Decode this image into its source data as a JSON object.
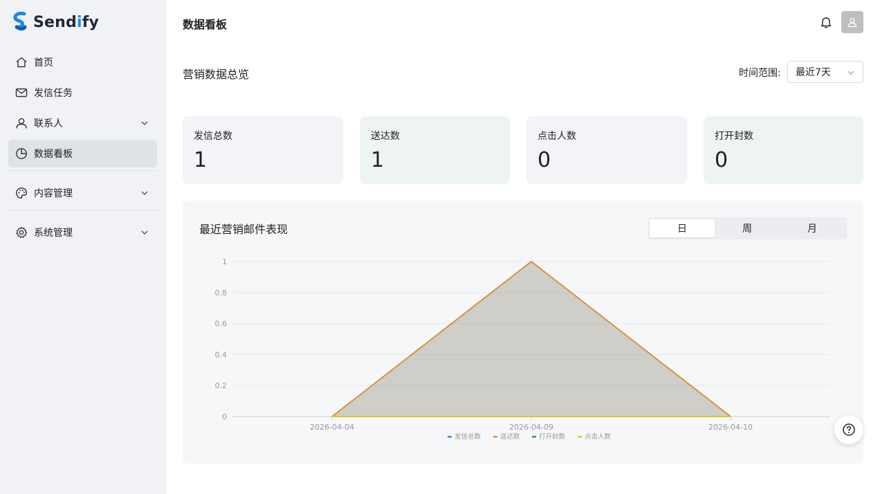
{
  "app": {
    "name_prefix": "Send",
    "name_accent": "i",
    "name_suffix": "fy"
  },
  "sidebar": {
    "items": [
      {
        "label": "首页",
        "icon": "home-icon"
      },
      {
        "label": "发信任务",
        "icon": "mail-icon"
      },
      {
        "label": "联系人",
        "icon": "user-icon",
        "expandable": true
      },
      {
        "label": "数据看板",
        "icon": "pie-chart-icon",
        "active": true
      },
      {
        "label": "内容管理",
        "icon": "palette-icon",
        "expandable": true
      },
      {
        "label": "系统管理",
        "icon": "gear-icon",
        "expandable": true
      }
    ]
  },
  "header": {
    "title": "数据看板"
  },
  "overview": {
    "title": "营销数据总览",
    "range_label": "时间范围:",
    "range_value": "最近7天"
  },
  "stats": [
    {
      "label": "发信总数",
      "value": "1"
    },
    {
      "label": "送达数",
      "value": "1"
    },
    {
      "label": "点击人数",
      "value": "0"
    },
    {
      "label": "打开封数",
      "value": "0"
    }
  ],
  "performance": {
    "title": "最近营销邮件表现",
    "periods": [
      {
        "label": "日",
        "active": true
      },
      {
        "label": "周",
        "active": false
      },
      {
        "label": "月",
        "active": false
      }
    ]
  },
  "colors": {
    "accent": "#1e88e5",
    "series_sent": "#3b82f6",
    "series_delivered": "#e8912a",
    "series_opened": "#22a06b",
    "series_clicked": "#f5c518"
  },
  "chart_data": {
    "type": "area",
    "x": [
      "2026-04-04",
      "2026-04-09",
      "2026-04-10"
    ],
    "ylim": [
      0,
      1
    ],
    "yticks": [
      "0",
      "0.2",
      "0.4",
      "0.6",
      "0.8",
      "1"
    ],
    "grid": true,
    "legend_position": "bottom",
    "series": [
      {
        "name": "发信总数",
        "values": [
          0,
          1,
          0
        ],
        "color": "#3b82f6"
      },
      {
        "name": "送达数",
        "values": [
          0,
          1,
          0
        ],
        "color": "#e8912a"
      },
      {
        "name": "打开封数",
        "values": [
          0,
          0,
          0
        ],
        "color": "#22a06b"
      },
      {
        "name": "点击人数",
        "values": [
          0,
          0,
          0
        ],
        "color": "#f5c518"
      }
    ]
  }
}
